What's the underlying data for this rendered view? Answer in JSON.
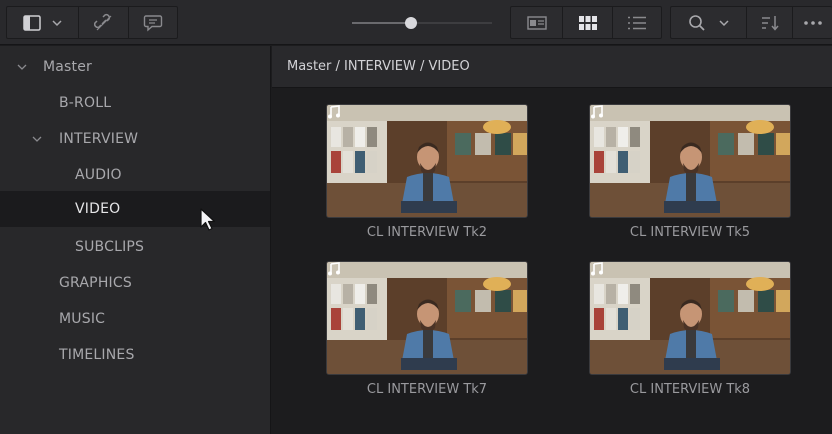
{
  "toolbar": {
    "icons": [
      "sidebar-toggle-icon",
      "chevron-down-icon",
      "unlink-icon",
      "text-bubble-icon",
      "metadata-view-icon",
      "thumbnail-view-icon",
      "list-view-icon",
      "search-icon",
      "sort-icon",
      "more-icon"
    ],
    "zoom_level": 0.42
  },
  "sidebar": {
    "items": [
      {
        "label": "Master",
        "depth": 0,
        "expanded": true
      },
      {
        "label": "B-ROLL",
        "depth": 1
      },
      {
        "label": "INTERVIEW",
        "depth": 1,
        "expanded": true
      },
      {
        "label": "AUDIO",
        "depth": 2
      },
      {
        "label": "VIDEO",
        "depth": 2,
        "selected": true
      },
      {
        "label": "SUBCLIPS",
        "depth": 2
      },
      {
        "label": "GRAPHICS",
        "depth": 1
      },
      {
        "label": "MUSIC",
        "depth": 1
      },
      {
        "label": "TIMELINES",
        "depth": 1
      }
    ]
  },
  "breadcrumb": "Master / INTERVIEW / VIDEO",
  "clips": [
    {
      "name": "CL INTERVIEW Tk2",
      "audio_icon": "music-note-icon"
    },
    {
      "name": "CL INTERVIEW Tk5",
      "audio_icon": "music-note-icon"
    },
    {
      "name": "CL INTERVIEW Tk7",
      "audio_icon": "music-note-icon"
    },
    {
      "name": "CL INTERVIEW Tk8",
      "audio_icon": "music-note-icon"
    }
  ],
  "colors": {
    "toolbar_bg": "#29292c",
    "sidebar_bg": "#28282a",
    "selected_row_bg": "#1b1b1d",
    "content_bg": "#1c1c1e",
    "active_icon": "#e4e4e8",
    "inactive_icon": "#8a8a8e"
  }
}
